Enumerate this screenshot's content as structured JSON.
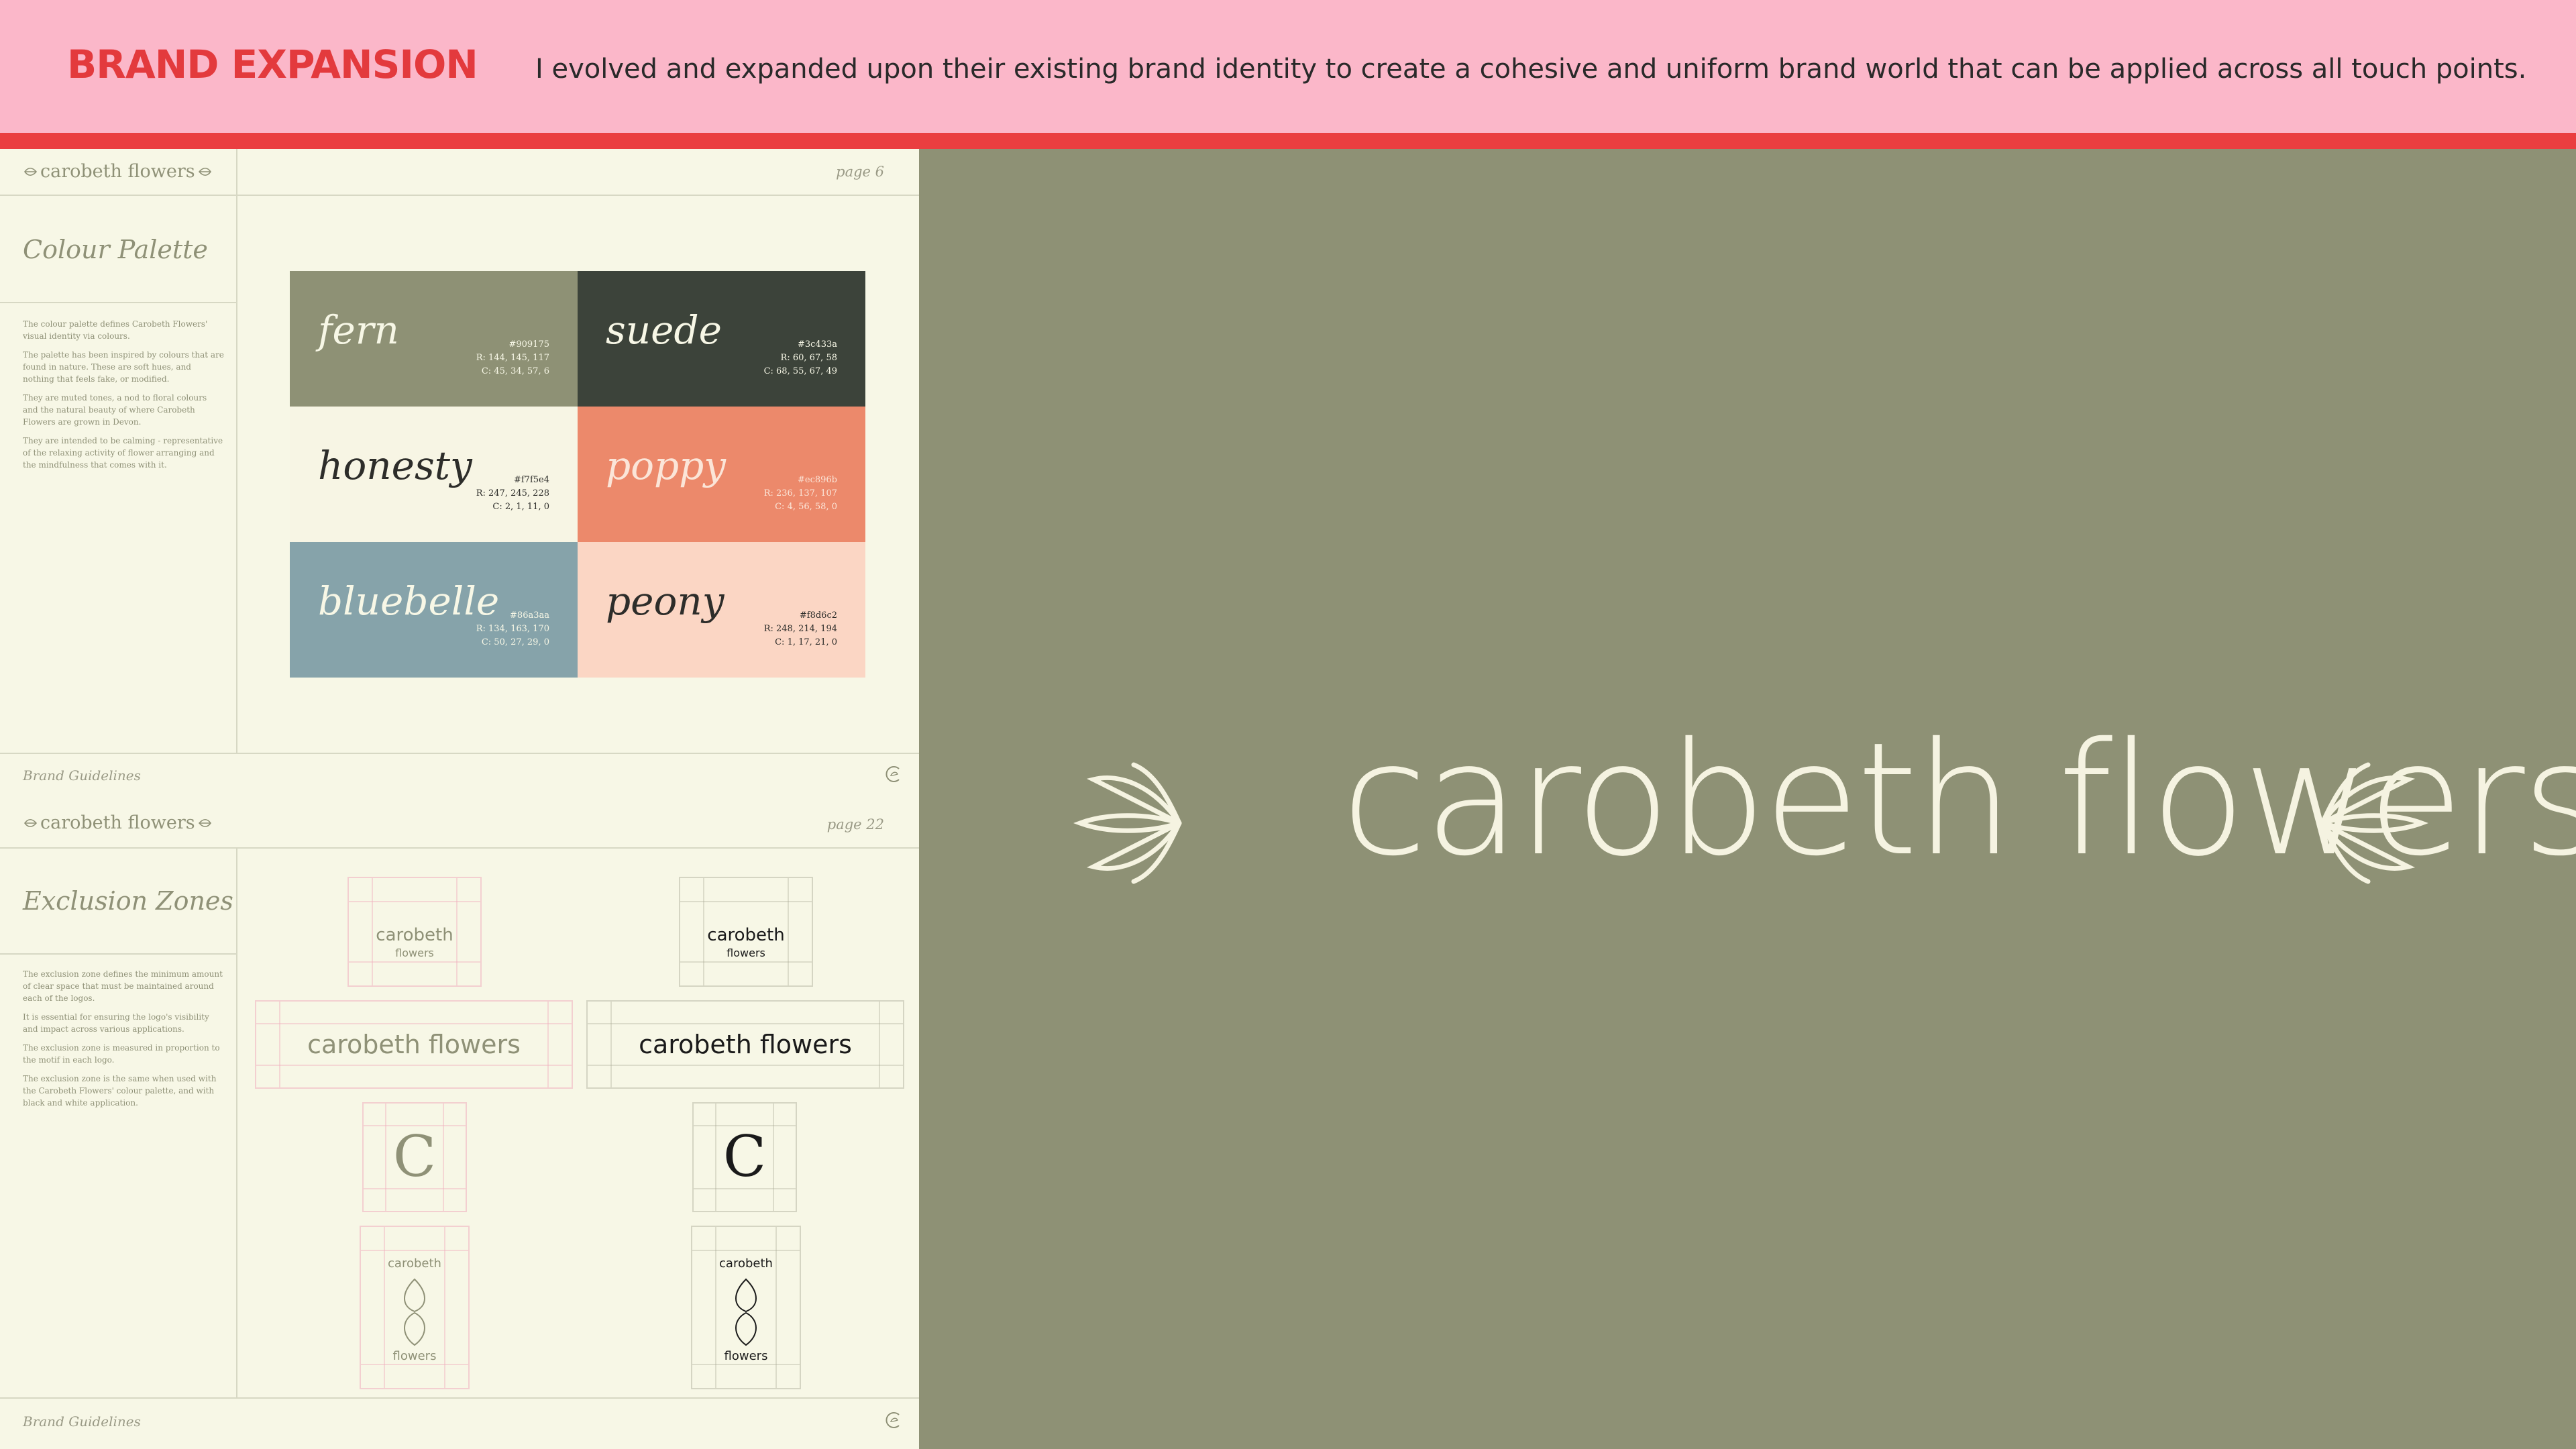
{
  "header": {
    "title": "BRAND EXPANSION",
    "description": "I evolved and expanded upon their existing brand identity to create a cohesive and uniform brand world that can be applied across all touch points."
  },
  "colors": {
    "header_bg": "#fbb7c9",
    "accent_red": "#ea3e40",
    "hero_bg": "#8e9175",
    "doc_bg": "#f7f7e6",
    "hero_text": "#f5f3e1"
  },
  "logo_small": "carobeth flowers",
  "page_palette": {
    "page_number": "page 6",
    "section_title": "Colour Palette",
    "body": [
      "The colour palette defines Carobeth Flowers' visual identity via colours.",
      "The palette has been inspired by colours that are found in nature. These are soft hues, and nothing that feels fake, or modified.",
      "They are muted tones, a nod to floral colours and the natural beauty of where Carobeth Flowers are grown in Devon.",
      "They are intended to be calming - representative of the relaxing activity of flower arranging and the mindfulness that comes with it."
    ],
    "footer": "Brand Guidelines",
    "swatches": [
      {
        "name": "fern",
        "hex": "#909175",
        "rgb": "R: 144, 145, 117",
        "cmyk": "C: 45, 34, 57, 6",
        "bg": "#8e9175",
        "fg": "#f7f7e6"
      },
      {
        "name": "suede",
        "hex": "#3c433a",
        "rgb": "R: 60, 67, 58",
        "cmyk": "C: 68, 55, 67, 49",
        "bg": "#3c433a",
        "fg": "#f7f7e6"
      },
      {
        "name": "honesty",
        "hex": "#f7f5e4",
        "rgb": "R: 247, 245, 228",
        "cmyk": "C: 2, 1, 11, 0",
        "bg": "#f7f5e4",
        "fg": "#2d2d2a"
      },
      {
        "name": "poppy",
        "hex": "#ec896b",
        "rgb": "R: 236, 137, 107",
        "cmyk": "C: 4, 56, 58, 0",
        "bg": "#ec896b",
        "fg": "#fbe5d8"
      },
      {
        "name": "bluebelle",
        "hex": "#86a3aa",
        "rgb": "R: 134, 163, 170",
        "cmyk": "C: 50, 27, 29, 0",
        "bg": "#86a3aa",
        "fg": "#f7f7e6"
      },
      {
        "name": "peony",
        "hex": "#f8d6c2",
        "rgb": "R: 248, 214, 194",
        "cmyk": "C: 1, 17, 21, 0",
        "bg": "#fbd6c4",
        "fg": "#2d2d2a"
      }
    ]
  },
  "page_exclusion": {
    "page_number": "page 22",
    "section_title": "Exclusion Zones",
    "body": [
      "The exclusion zone defines the minimum amount of clear space that must be maintained around each of the logos.",
      "It is essential for ensuring the logo's visibility and impact across various applications.",
      "The exclusion zone is measured in proportion to the motif in each logo.",
      "The exclusion zone is the same when used with the Carobeth Flowers' colour palette, and with black and white application."
    ],
    "footer": "Brand Guidelines",
    "stacked_word_1": "carobeth",
    "stacked_word_2": "flowers",
    "wordmark": "carobeth flowers",
    "monogram": "C"
  },
  "hero": {
    "wordmark": "carobeth flowers"
  }
}
